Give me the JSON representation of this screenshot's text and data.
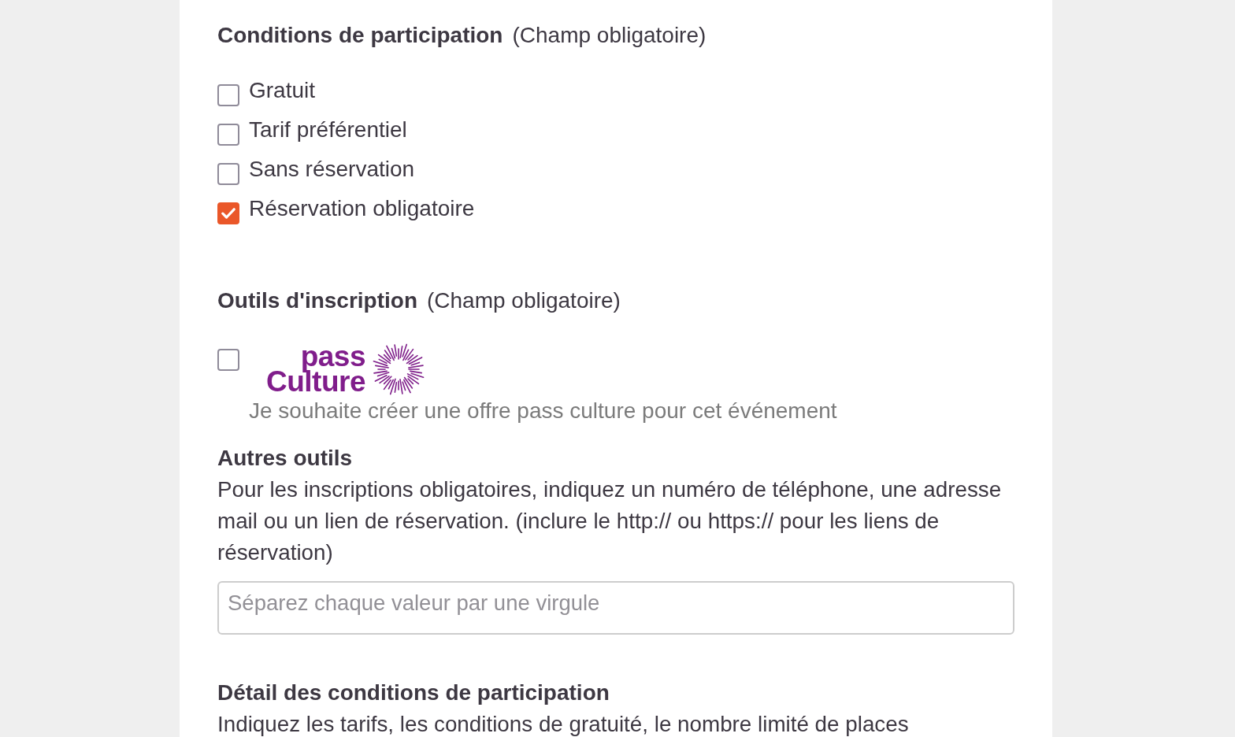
{
  "participation_conditions": {
    "title": "Conditions de participation",
    "note": "(Champ obligatoire)",
    "options": [
      {
        "label": "Gratuit",
        "checked": false
      },
      {
        "label": "Tarif préférentiel",
        "checked": false
      },
      {
        "label": "Sans réservation",
        "checked": false
      },
      {
        "label": "Réservation obligatoire",
        "checked": true
      }
    ]
  },
  "registration_tools": {
    "title": "Outils d'inscription",
    "note": "(Champ obligatoire)",
    "pass_culture": {
      "checked": false,
      "logo_lines": [
        "pass",
        "Culture"
      ],
      "description": "Je souhaite créer une offre pass culture pour cet événement"
    }
  },
  "other_tools": {
    "title": "Autres outils",
    "help": "Pour les inscriptions obligatoires, indiquez un numéro de téléphone, une adresse mail ou un lien de réservation. (inclure le http:// ou https:// pour les liens de réservation)",
    "input": {
      "placeholder": "Séparez chaque valeur par une virgule"
    }
  },
  "details": {
    "title": "Détail des conditions de participation",
    "help": "Indiquez les tarifs, les conditions de gratuité, le nombre limité de places"
  }
}
